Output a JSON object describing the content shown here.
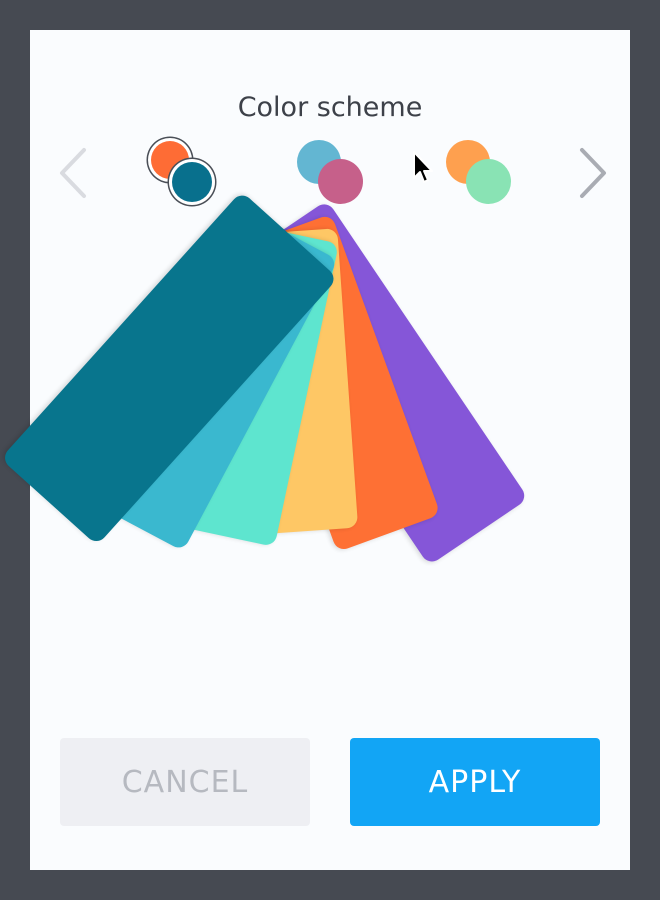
{
  "dialog": {
    "title": "Color scheme"
  },
  "picker": {
    "schemes": [
      {
        "name": "orange-teal",
        "selected": true,
        "colors": [
          "#fe6c35",
          "#08708d"
        ]
      },
      {
        "name": "blue-rose",
        "selected": false,
        "colors": [
          "#63b6d2",
          "#c6608a"
        ]
      },
      {
        "name": "orange-mint",
        "selected": false,
        "colors": [
          "#fea04f",
          "#89e3b4"
        ]
      }
    ],
    "prev_icon": "chevron-left-icon",
    "next_icon": "chevron-right-icon"
  },
  "preview": {
    "palette": [
      "#8556d8",
      "#fe7034",
      "#fec765",
      "#5ee5cf",
      "#3ab8cf",
      "#08758d"
    ]
  },
  "actions": {
    "cancel_label": "CANCEL",
    "apply_label": "APPLY",
    "apply_color": "#12a5f5"
  },
  "cursor_icon": "mouse-pointer-icon"
}
